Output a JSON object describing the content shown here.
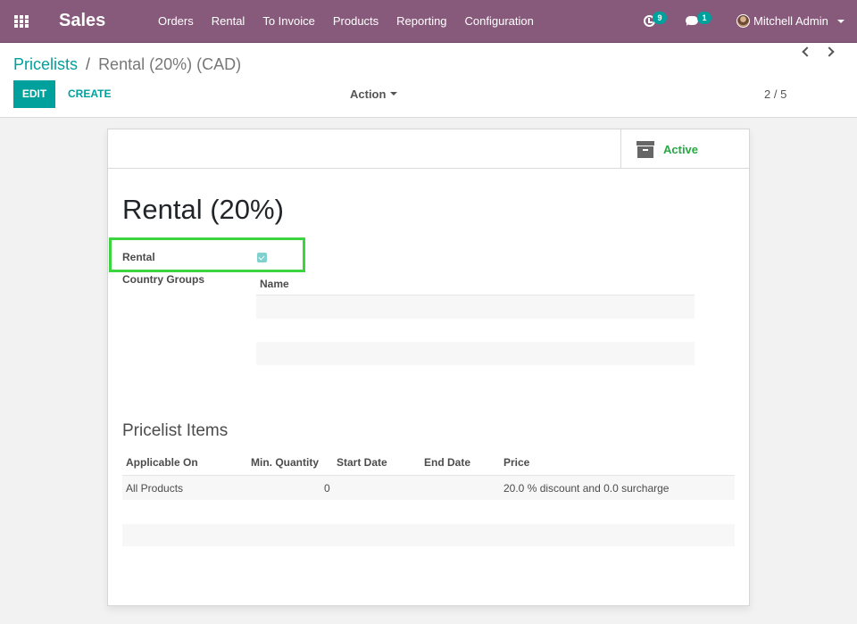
{
  "navbar": {
    "app_name": "Sales",
    "menu": [
      "Orders",
      "Rental",
      "To Invoice",
      "Products",
      "Reporting",
      "Configuration"
    ],
    "activity_count": "9",
    "message_count": "1",
    "user_name": "Mitchell Admin",
    "icons": [
      "apps-grid-icon",
      "activity-clock-icon",
      "chat-bubble-icon",
      "user-avatar",
      "chevron-down-icon"
    ]
  },
  "control_panel": {
    "breadcrumb_parent": "Pricelists",
    "breadcrumb_separator": "/",
    "breadcrumb_current": "Rental (20%) (CAD)",
    "edit_label": "EDIT",
    "create_label": "CREATE",
    "action_label": "Action",
    "pager": "2 / 5"
  },
  "form": {
    "status_button": "Active",
    "title": "Rental (20%)",
    "rental_label": "Rental",
    "rental_checked": true,
    "country_groups_label": "Country Groups",
    "country_groups_columns": [
      "Name"
    ],
    "pricelist_items_title": "Pricelist Items",
    "items_columns": [
      "Applicable On",
      "Min. Quantity",
      "Start Date",
      "End Date",
      "Price"
    ],
    "items_rows": [
      {
        "applicable_on": "All Products",
        "min_quantity": "0",
        "start_date": "",
        "end_date": "",
        "price": "20.0 % discount and 0.0 surcharge"
      }
    ]
  },
  "colors": {
    "navbar": "#875a7b",
    "primary": "#00a09d",
    "active_status": "#28a745",
    "highlight": "#3cd43f"
  }
}
